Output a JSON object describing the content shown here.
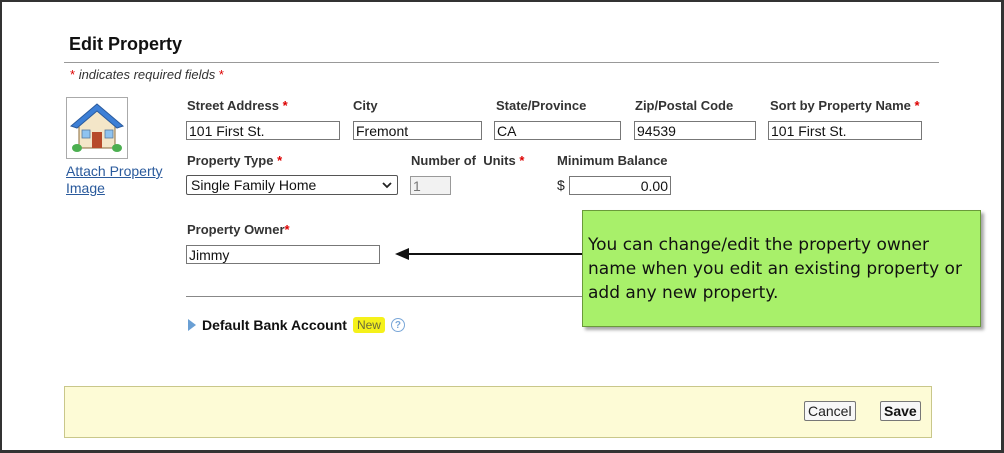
{
  "page": {
    "title": "Edit Property",
    "required_note": "indicates required fields",
    "required_star": "*"
  },
  "image": {
    "icon": "house-icon",
    "attach_link": "Attach Property Image"
  },
  "fields": {
    "street_address": {
      "label": "Street Address",
      "required": true,
      "value": "101 First St."
    },
    "city": {
      "label": "City",
      "value": "Fremont"
    },
    "state": {
      "label": "State/Province",
      "value": "CA"
    },
    "zip": {
      "label": "Zip/Postal Code",
      "value": "94539"
    },
    "sort_name": {
      "label": "Sort by Property Name",
      "required": true,
      "value": "101 First St."
    },
    "property_type": {
      "label": "Property Type",
      "required": true,
      "value": "Single Family Home"
    },
    "units": {
      "label": "Number of  Units",
      "required": true,
      "value": "1"
    },
    "min_balance": {
      "label": "Minimum Balance",
      "currency": "$",
      "value": "0.00"
    },
    "owner": {
      "label": "Property Owner",
      "required": true,
      "value": "Jimmy"
    }
  },
  "bank": {
    "label": "Default Bank Account",
    "badge": "New",
    "help": "?"
  },
  "callout": {
    "text": "You can change/edit the property owner name when you edit an existing property or add any new property."
  },
  "actions": {
    "cancel": "Cancel",
    "save": "Save"
  },
  "colors": {
    "callout_bg": "#a8f06a",
    "footer_bg": "#fdfbd6",
    "required_star": "#dd0000",
    "link": "#2a5a9c",
    "badge_bg": "#f5f11a"
  }
}
